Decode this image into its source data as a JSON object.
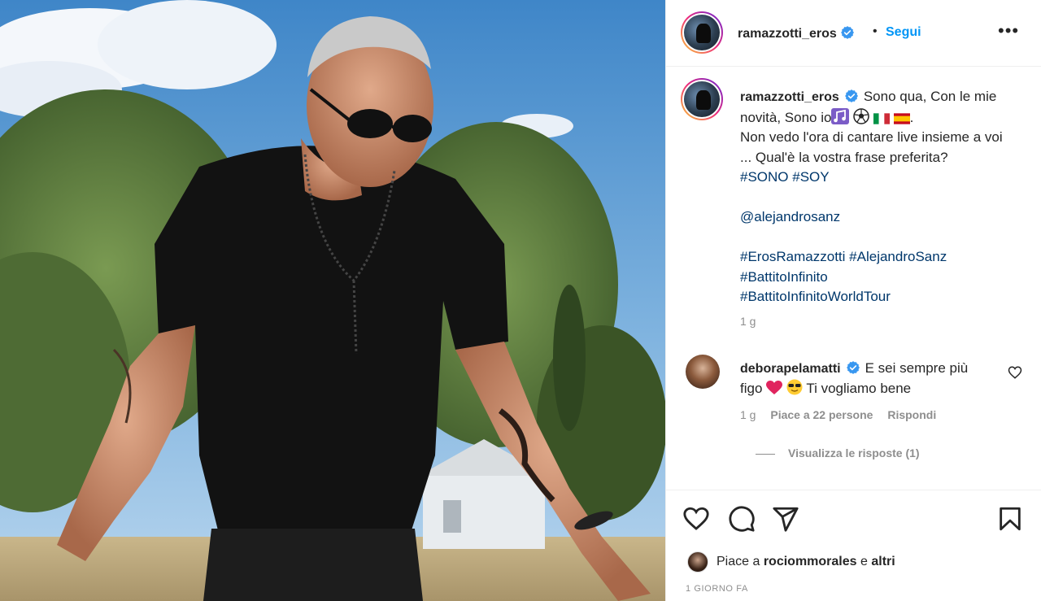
{
  "post": {
    "author": {
      "username": "ramazzotti_eros",
      "verified": true,
      "follow_label": "Segui",
      "separator": "•"
    },
    "more_options": "•••",
    "caption": {
      "line1": "Sono qua, Con le mie novità, Sono io",
      "line1_suffix": ".",
      "line2": "Non vedo l'ora di cantare live insieme a voi ... Qual'è la vostra frase preferita?",
      "hashtags_1": [
        "#SONO",
        "#SOY"
      ],
      "mention": "@alejandrosanz",
      "hashtags_2": [
        "#ErosRamazzotti",
        "#AlejandroSanz",
        "#BattitoInfinito",
        "#BattitoInfinitoWorldTour"
      ]
    },
    "age": "1 g"
  },
  "comment": {
    "username": "deborapelamatti",
    "verified": true,
    "text_before": "E sei sempre più figo",
    "text_after": "Ti vogliamo bene",
    "age": "1 g",
    "likes": "Piace a 22 persone",
    "reply_label": "Rispondi",
    "view_replies": "Visualizza le risposte (1)"
  },
  "likes": {
    "prefix": "Piace a",
    "user": "rociommorales",
    "joiner": "e",
    "others": "altri"
  },
  "date": "1 GIORNO FA",
  "icons": {
    "verified": "verified-badge-icon",
    "like": "heart-icon",
    "comment": "comment-icon",
    "share": "paper-plane-icon",
    "save": "bookmark-icon"
  },
  "colors": {
    "accent_blue": "#0095f6",
    "hashtag": "#00376b",
    "muted": "#8e8e8e",
    "text": "#262626"
  }
}
